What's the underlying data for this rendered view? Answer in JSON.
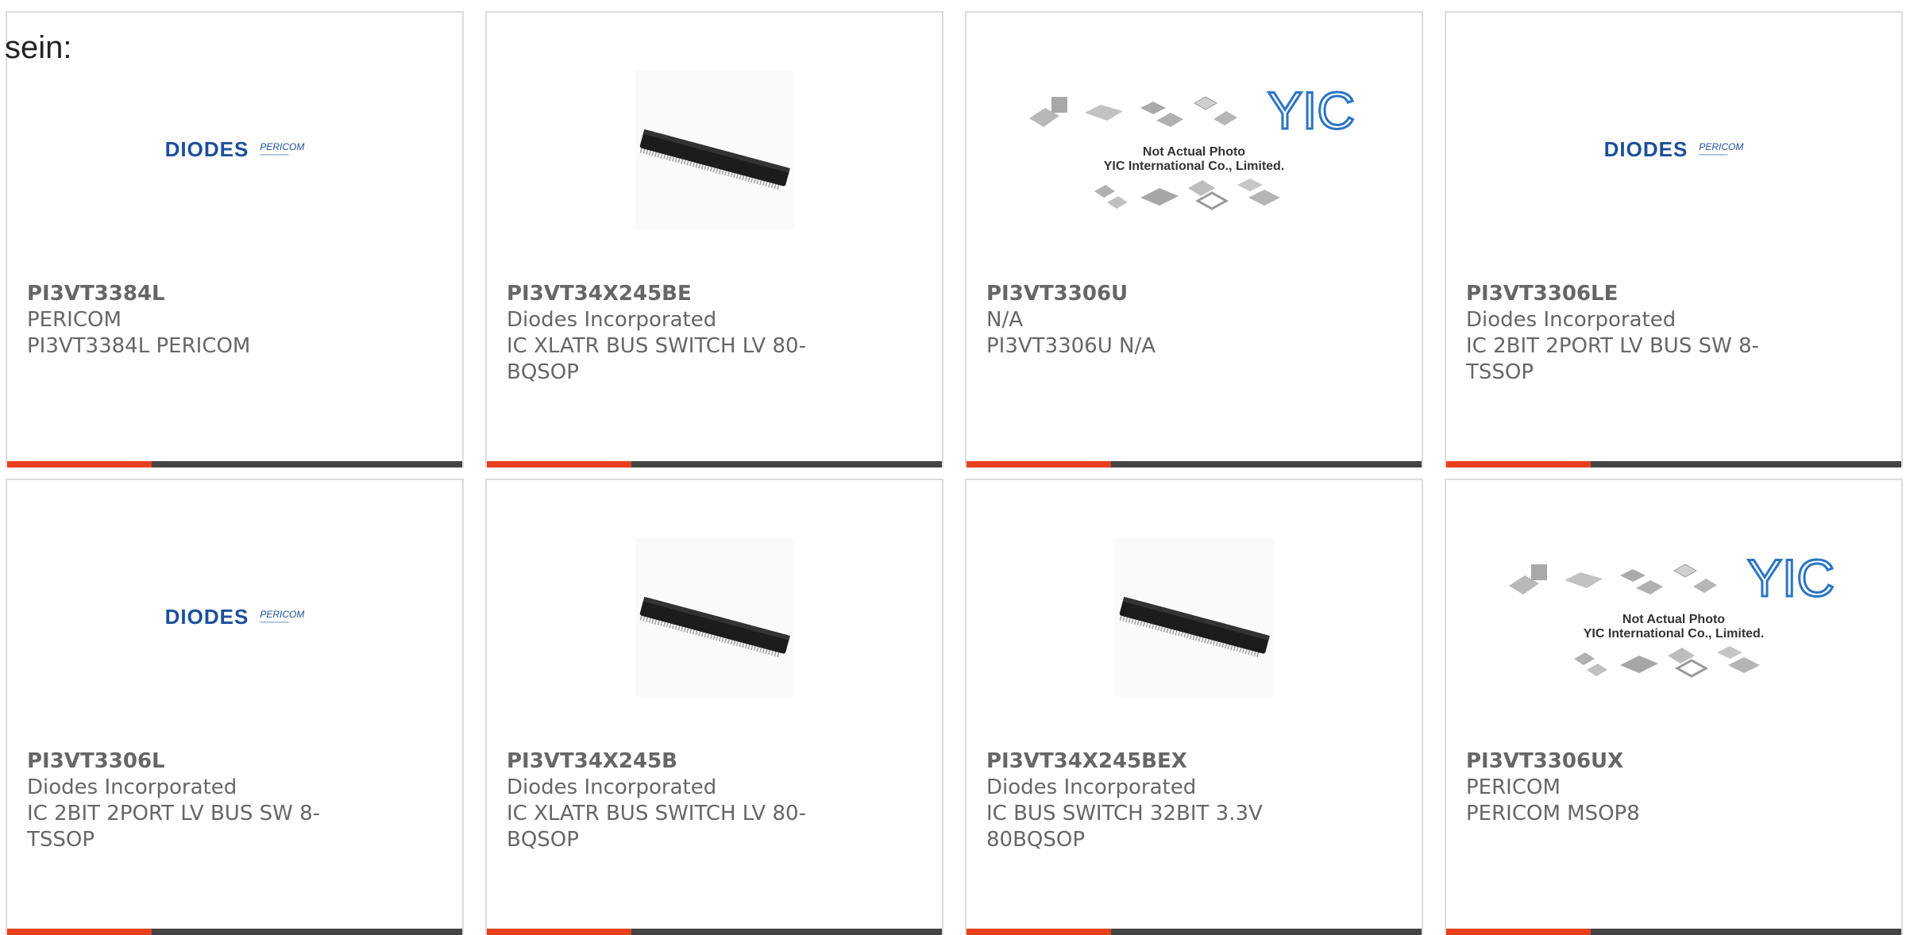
{
  "prefix_text": "sein:",
  "colors": {
    "accent": "#e8401c",
    "bar": "#444444",
    "text": "#666666",
    "border": "#dcdcdc"
  },
  "products": [
    {
      "part": "PI3VT3384L",
      "manufacturer": "PERICOM",
      "description": "PI3VT3384L PERICOM",
      "image": "diodes-pericom-logo"
    },
    {
      "part": "PI3VT34X245BE",
      "manufacturer": "Diodes Incorporated",
      "description": "IC XLATR BUS SWITCH LV 80-BQSOP",
      "image": "ic-chip-photo"
    },
    {
      "part": "PI3VT3306U",
      "manufacturer": "N/A",
      "description": "PI3VT3306U N/A",
      "image": "yic-not-actual-photo"
    },
    {
      "part": "PI3VT3306LE",
      "manufacturer": "Diodes Incorporated",
      "description": "IC 2BIT 2PORT LV BUS SW 8-TSSOP",
      "image": "diodes-pericom-logo"
    },
    {
      "part": "PI3VT3306L",
      "manufacturer": "Diodes Incorporated",
      "description": "IC 2BIT 2PORT LV BUS SW 8-TSSOP",
      "image": "diodes-pericom-logo"
    },
    {
      "part": "PI3VT34X245B",
      "manufacturer": "Diodes Incorporated",
      "description": "IC XLATR BUS SWITCH LV 80-BQSOP",
      "image": "ic-chip-photo"
    },
    {
      "part": "PI3VT34X245BEX",
      "manufacturer": "Diodes Incorporated",
      "description": "IC BUS SWITCH 32BIT 3.3V 80BQSOP",
      "image": "ic-chip-photo"
    },
    {
      "part": "PI3VT3306UX",
      "manufacturer": "PERICOM",
      "description": "PERICOM MSOP8",
      "image": "yic-not-actual-photo"
    }
  ],
  "logo_text": {
    "diodes": "DIODES",
    "pericom": "PERICOM"
  },
  "yic_text": {
    "brand": "YIC",
    "line1": "Not Actual Photo",
    "line2": "YIC International Co., Limited."
  }
}
